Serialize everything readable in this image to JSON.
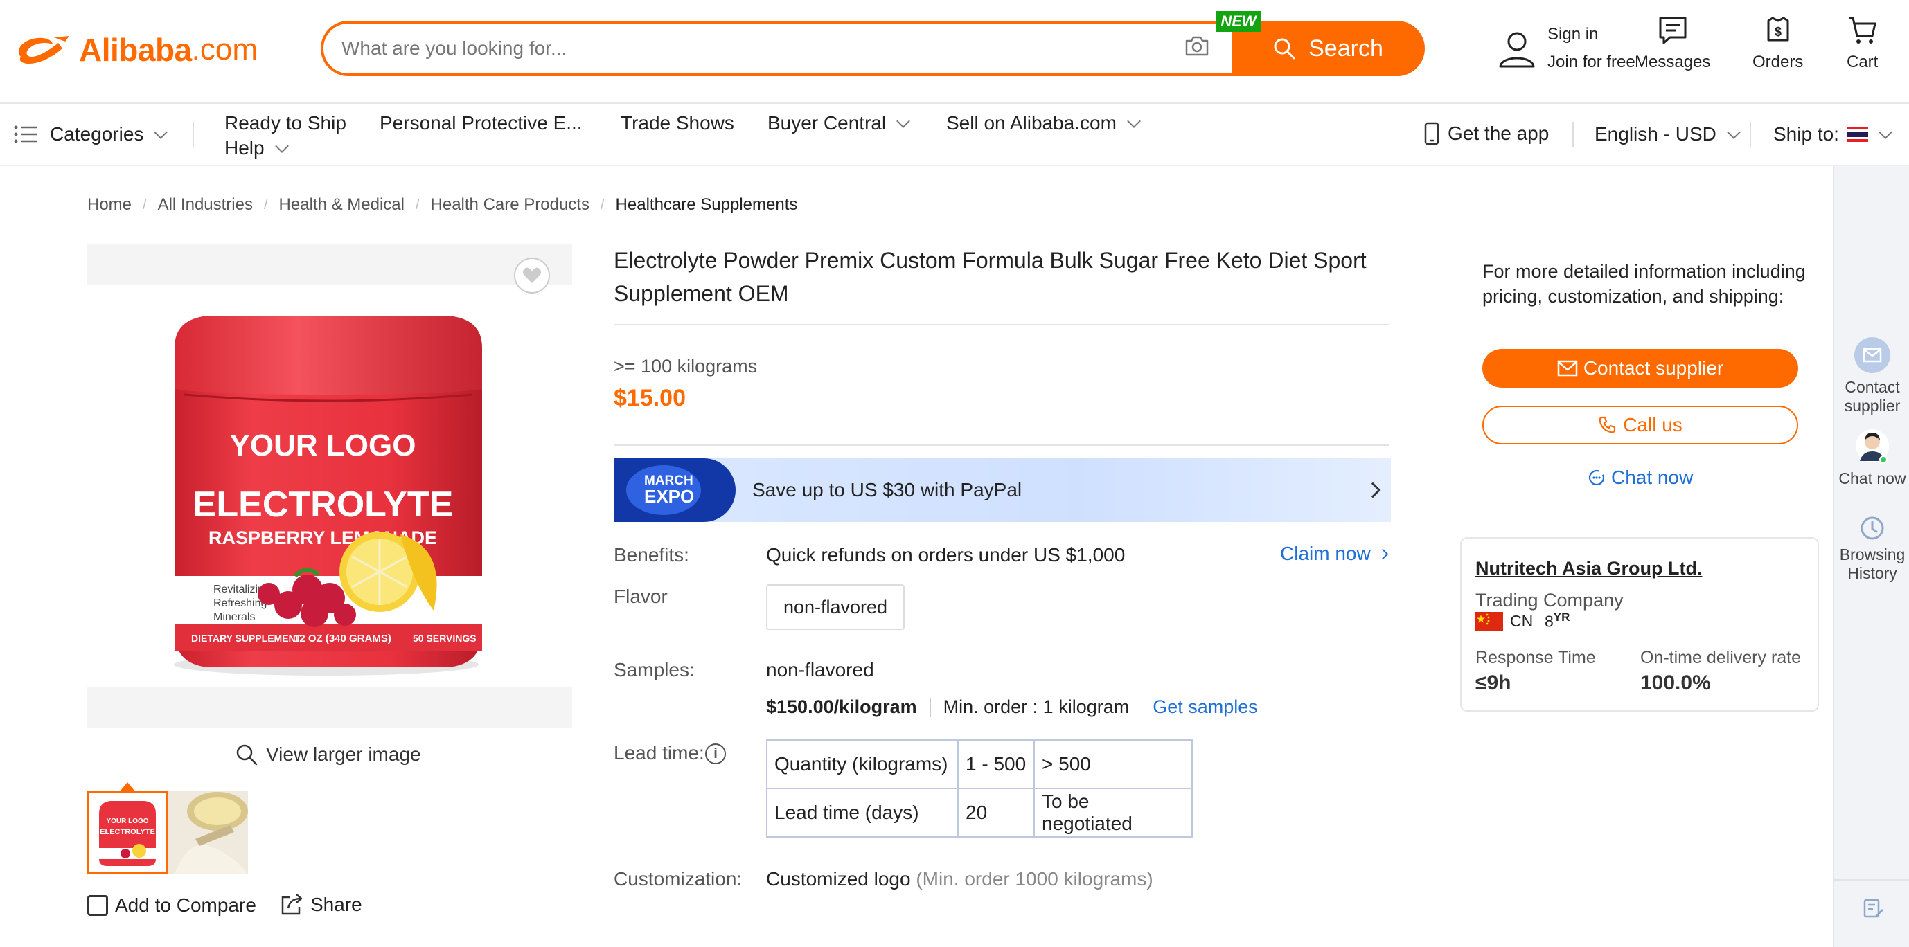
{
  "header": {
    "logo_word": "Alibaba",
    "logo_suffix": ".com",
    "search_placeholder": "What are you looking for...",
    "new_badge": "NEW",
    "search_button": "Search",
    "sign_in": "Sign in",
    "join_free": "Join for free",
    "messages": "Messages",
    "orders": "Orders",
    "cart": "Cart"
  },
  "nav": {
    "categories": "Categories",
    "ready_to_ship": "Ready to Ship",
    "ppe": "Personal Protective E...",
    "trade_shows": "Trade Shows",
    "buyer_central": "Buyer Central",
    "sell": "Sell on Alibaba.com",
    "help": "Help",
    "get_app": "Get the app",
    "language": "English - USD",
    "ship_to": "Ship to:"
  },
  "breadcrumb": [
    "Home",
    "All Industries",
    "Health & Medical",
    "Health Care Products",
    "Healthcare Supplements"
  ],
  "gallery": {
    "view_larger": "View larger image",
    "add_compare": "Add to Compare",
    "share": "Share",
    "product_art": {
      "logo": "YOUR LOGO",
      "name": "ELECTROLYTE",
      "flavor": "RASPBERRY LEMONADE",
      "benefits": [
        "Revitalizing",
        "Refreshing",
        "Minerals"
      ],
      "footer_left": "DIETARY SUPPLEMENT",
      "footer_mid": "12 OZ (340 GRAMS)",
      "footer_right": "50 SERVINGS"
    }
  },
  "product": {
    "title": "Electrolyte Powder Premix Custom Formula Bulk Sugar Free Keto Diet Sport Supplement OEM",
    "moq": ">= 100 kilograms",
    "price": "$15.00",
    "promo": {
      "badge_top": "MARCH",
      "badge_bottom": "EXPO",
      "text": "Save up to US $30 with PayPal"
    },
    "benefits_label": "Benefits:",
    "benefits_value": "Quick refunds on orders under US $1,000",
    "claim_now": "Claim now",
    "flavor_label": "Flavor",
    "flavor_option": "non-flavored",
    "samples_label": "Samples:",
    "samples_value": "non-flavored",
    "sample_price": "$150.00/kilogram",
    "sample_min": "Min. order : 1 kilogram",
    "get_samples": "Get samples",
    "lead_label": "Lead time:",
    "lead_table": {
      "row1": [
        "Quantity (kilograms)",
        "1 - 500",
        "> 500"
      ],
      "row2": [
        "Lead time (days)",
        "20",
        "To be negotiated"
      ]
    },
    "customization_label": "Customization:",
    "customization_value": "Customized logo",
    "customization_note": "(Min. order 1000 kilograms)"
  },
  "right_panel": {
    "more_info": "For more detailed information including pricing, customization, and shipping:",
    "contact_supplier": "Contact supplier",
    "call_us": "Call us",
    "chat_now": "Chat now",
    "supplier": {
      "name": "Nutritech Asia Group Ltd.",
      "type": "Trading Company",
      "country": "CN",
      "years": "8",
      "years_unit": "YR",
      "response_label": "Response Time",
      "response_value": "≤9h",
      "otd_label": "On-time delivery rate",
      "otd_value": "100.0%"
    }
  },
  "float_bar": {
    "contact": "Contact supplier",
    "chat": "Chat now",
    "history": "Browsing History"
  },
  "colors": {
    "brand": "#ff6a00",
    "link": "#1f6fd6",
    "new_badge": "#14a311",
    "expo": "#1238a8"
  }
}
